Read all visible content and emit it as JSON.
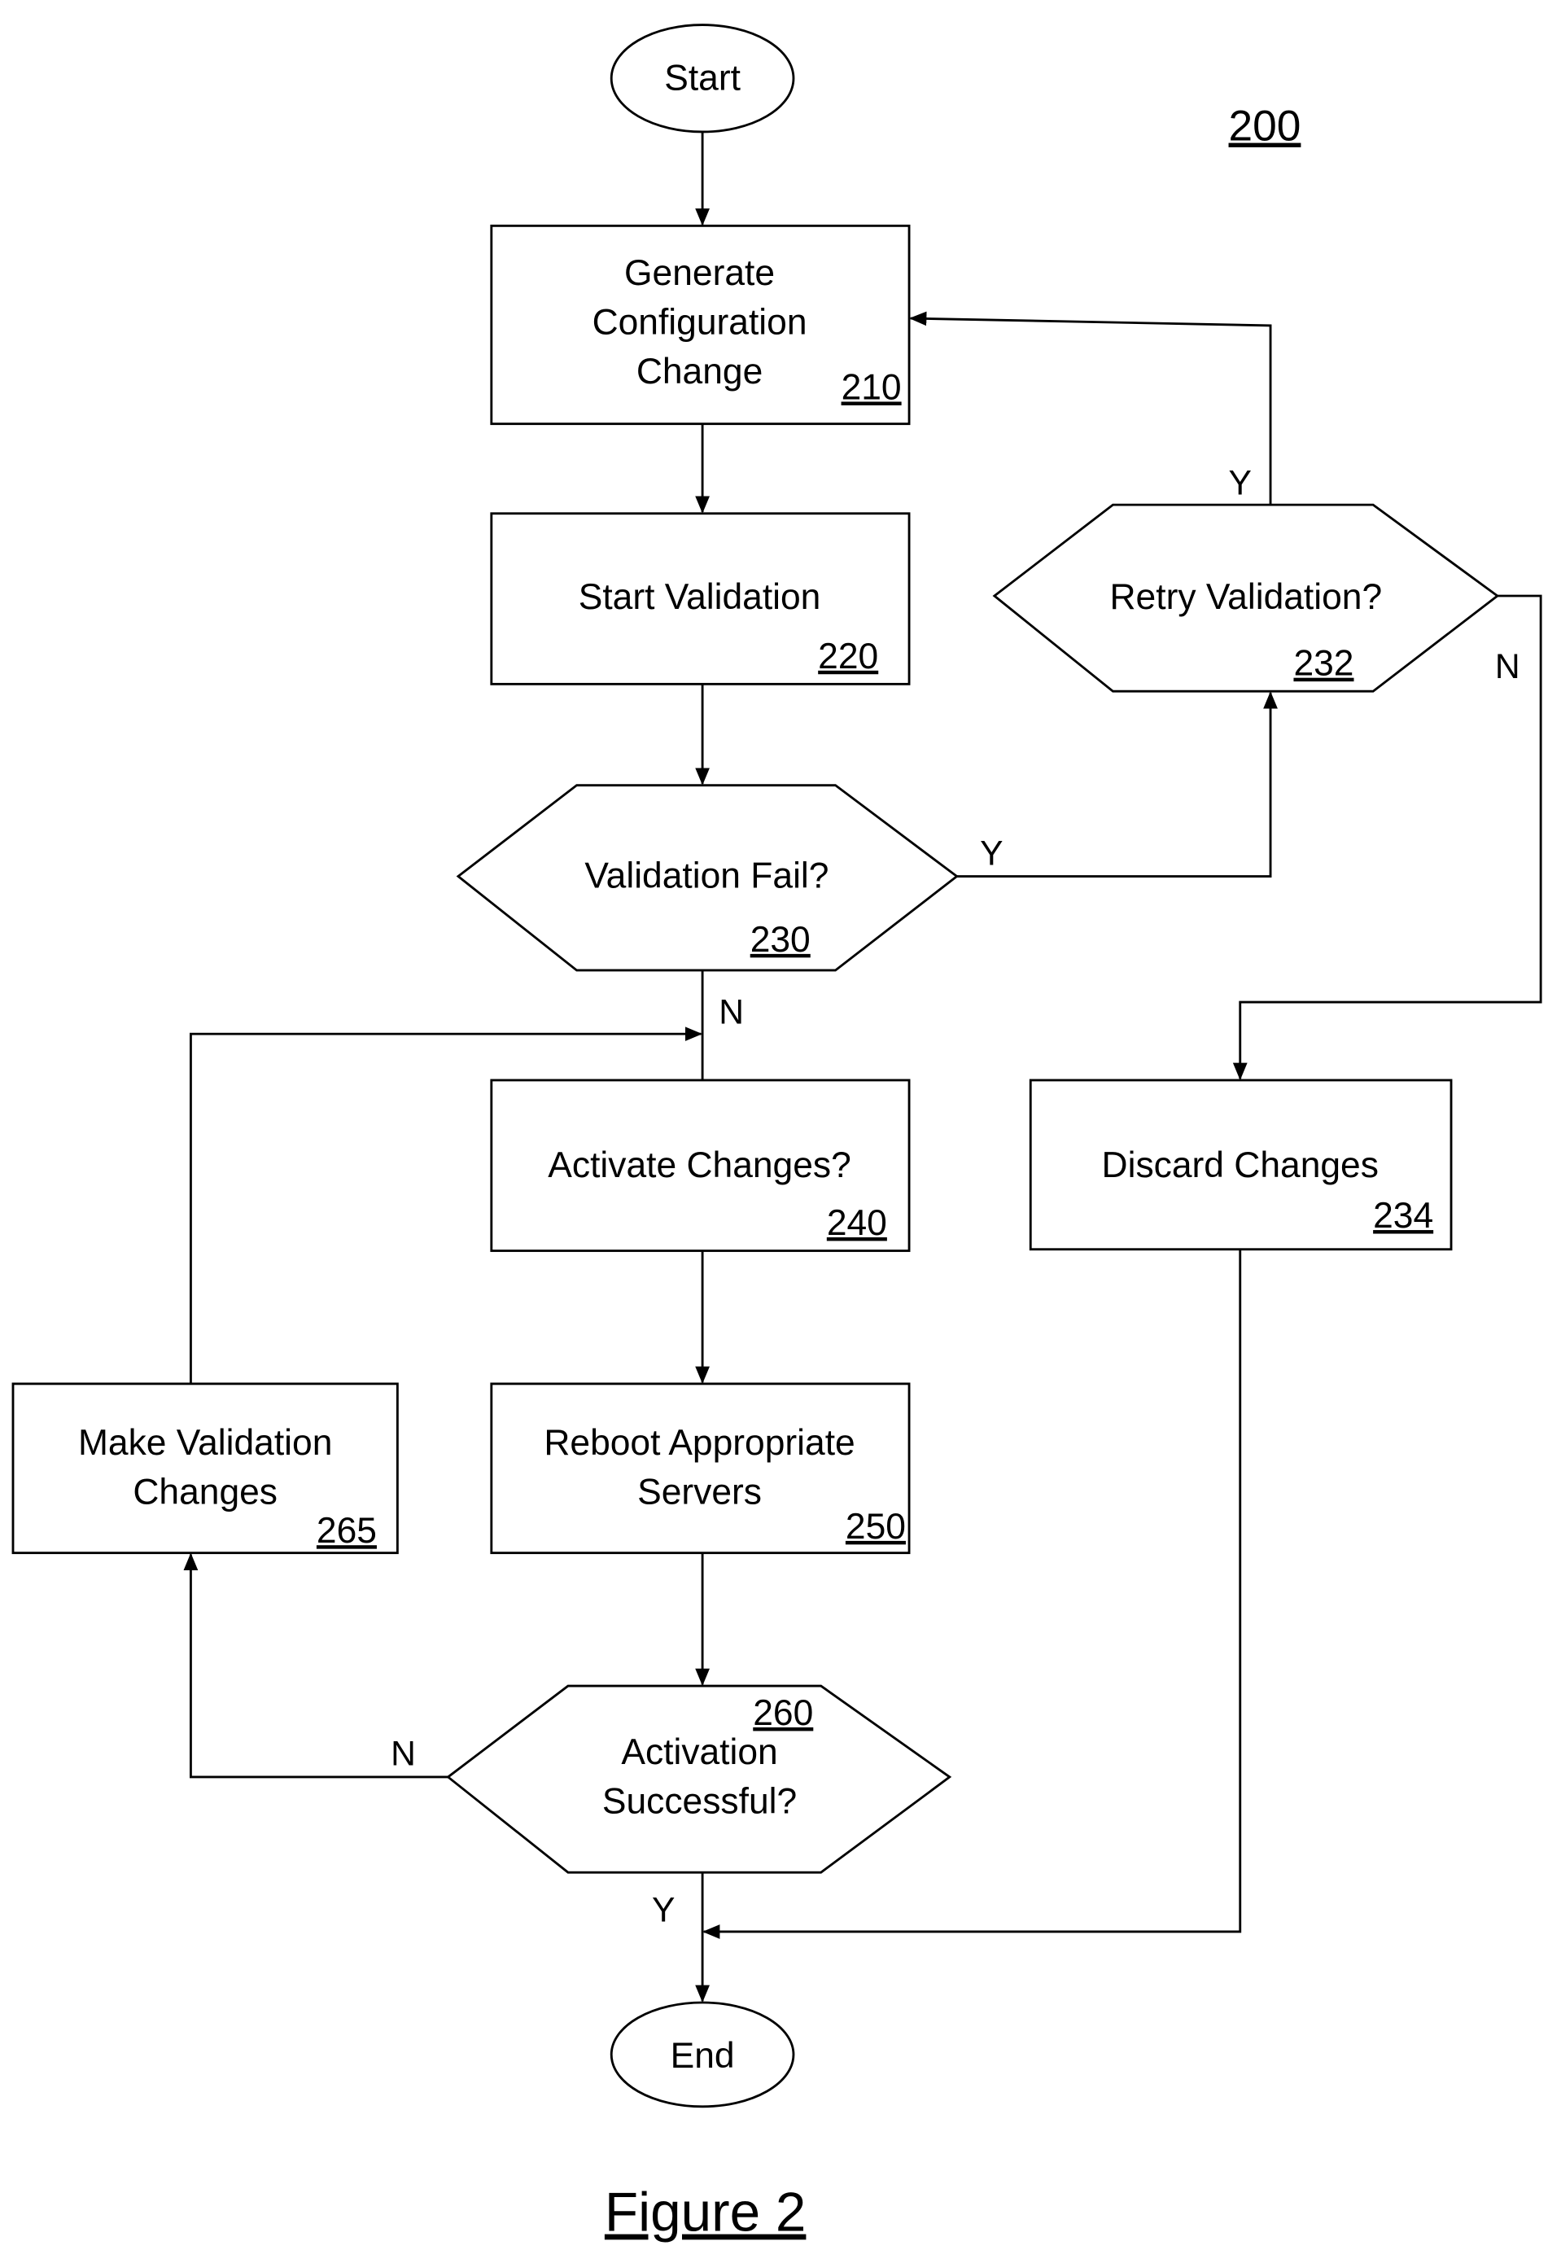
{
  "diagram": {
    "number": "200",
    "caption": "Figure 2",
    "nodes": {
      "start": {
        "label": "Start"
      },
      "n210": {
        "lines": [
          "Generate",
          "Configuration",
          "Change"
        ],
        "ref": "210"
      },
      "n220": {
        "lines": [
          "Start Validation"
        ],
        "ref": "220"
      },
      "n230": {
        "lines": [
          "Validation Fail?"
        ],
        "ref": "230"
      },
      "n232": {
        "lines": [
          "Retry Validation?"
        ],
        "ref": "232"
      },
      "n234": {
        "lines": [
          "Discard Changes"
        ],
        "ref": "234"
      },
      "n240": {
        "lines": [
          "Activate Changes?"
        ],
        "ref": "240"
      },
      "n250": {
        "lines": [
          "Reboot Appropriate",
          "Servers"
        ],
        "ref": "250"
      },
      "n260": {
        "lines": [
          "Activation",
          "Successful?"
        ],
        "ref": "260"
      },
      "n265": {
        "lines": [
          "Make Validation",
          "Changes"
        ],
        "ref": "265"
      },
      "end": {
        "label": "End"
      }
    },
    "edge_labels": {
      "y_232_to_210": "Y",
      "n_232_to_234": "N",
      "y_230_to_232": "Y",
      "n_230_to_240": "N",
      "n_260_to_265": "N",
      "y_260_to_end": "Y"
    }
  }
}
